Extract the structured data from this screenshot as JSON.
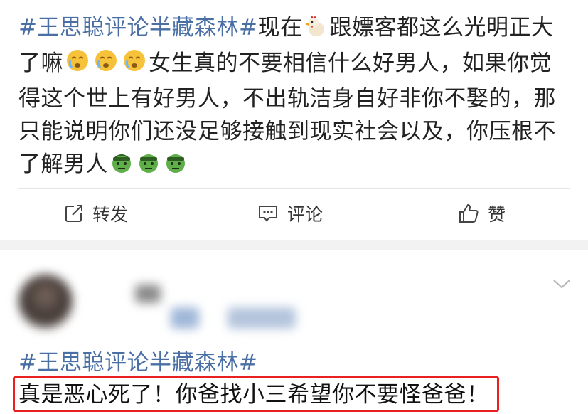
{
  "post": {
    "hashtag": "#王思聪评论半藏森林#",
    "text_1": "现在",
    "text_2": "跟嫖客都这么光明正大了嘛",
    "text_3": "女生真的不要相信什么好男人，如果你觉得这个世上有好男人，不出轨洁身自好非你不娶的，那只能说明你们还没足够接触到现实社会以及，你压根不了解男人",
    "emojis": [
      "chicken-emoji",
      "crying-face-emoji",
      "crying-face-emoji",
      "crying-face-emoji",
      "green-face-emoji",
      "green-face-emoji",
      "green-face-emoji"
    ]
  },
  "actions": {
    "repost_label": "转发",
    "comment_label": "评论",
    "like_label": "赞"
  },
  "comment": {
    "hashtag": "#王思聪评论半藏森林#",
    "body": "真是恶心死了！你爸找小三希望你不要怪爸爸！",
    "highlight_color": "#e8201f"
  }
}
